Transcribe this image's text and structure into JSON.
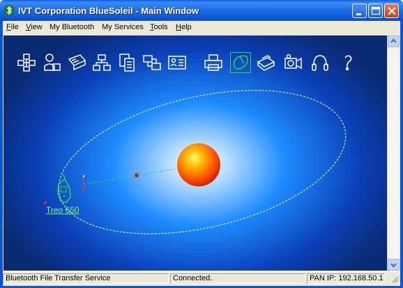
{
  "window": {
    "title": "IVT Corporation BlueSoleil - Main Window"
  },
  "menu": [
    {
      "label": "File",
      "underline": "F",
      "rest": "ile"
    },
    {
      "label": "View",
      "underline": "V",
      "rest": "iew"
    },
    {
      "label": "My Bluetooth",
      "underline": "",
      "rest": "My Bluetooth"
    },
    {
      "label": "My Services",
      "underline": "",
      "rest": "My Services"
    },
    {
      "label": "Tools",
      "underline": "T",
      "rest": "ools"
    },
    {
      "label": "Help",
      "underline": "H",
      "rest": "elp"
    }
  ],
  "toolbar": {
    "icons": [
      "personal-area-network-icon",
      "dial-up-networking-icon",
      "serial-port-icon",
      "lan-access-icon",
      "file-transfer-icon",
      "synchronization-icon",
      "business-card-icon",
      "printer-icon",
      "hid-mouse-icon",
      "fax-icon",
      "av-headset-icon",
      "headphones-icon",
      "headset-icon"
    ],
    "selected": "hid-mouse-icon"
  },
  "devices": [
    {
      "name": "Treo 650",
      "icon": "mobile-phone-icon",
      "color": "#00ff66"
    }
  ],
  "status": {
    "service": "Bluetooth File Transfer Service",
    "connection": "Connected.",
    "pan_ip": "PAN IP: 192.168.50.1"
  },
  "colors": {
    "titlebar": "#0b57d8",
    "stage_center": "#ffffff",
    "stage_edge": "#0a2a73",
    "orbit": "#ffffff",
    "device": "#00ff66"
  }
}
